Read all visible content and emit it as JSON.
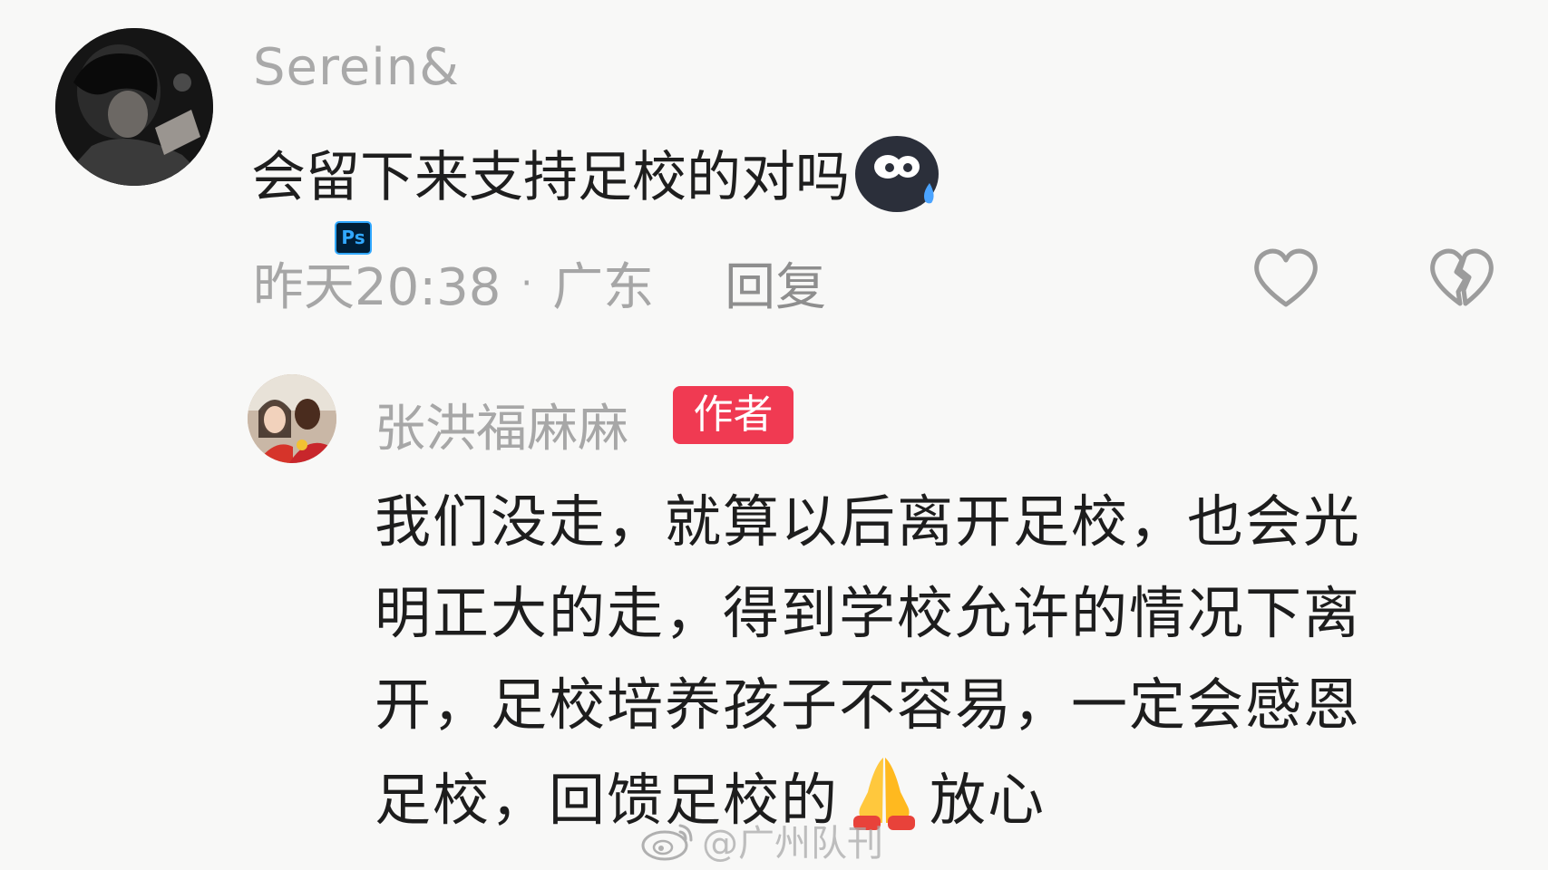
{
  "comment": {
    "username": "Serein&",
    "text": "会留下来支持足校的对吗",
    "emoji_icon": "sweat-smile-emoji-icon",
    "time": "昨天20:38",
    "separator": "·",
    "location": "广东",
    "reply_label": "回复",
    "ps_badge": "Ps"
  },
  "reply": {
    "username": "张洪福麻麻",
    "badge": "作者",
    "lines": [
      "我们没走，就算以后离开足校，也会光",
      "明正大的走，得到学校允许的情况下离",
      "开，足校培养孩子不容易，一定会感恩"
    ],
    "last_line_before_emoji": "足校，回馈足校的",
    "last_line_after_emoji": "放心",
    "emoji_icon": "praying-hands-emoji-icon"
  },
  "watermark": {
    "text": "@广州队刊",
    "icon": "weibo-icon"
  },
  "colors": {
    "background": "#f8f8f7",
    "author_badge": "#f03a52",
    "muted_text": "#a6a6a6",
    "main_text": "#1e1e1e"
  }
}
